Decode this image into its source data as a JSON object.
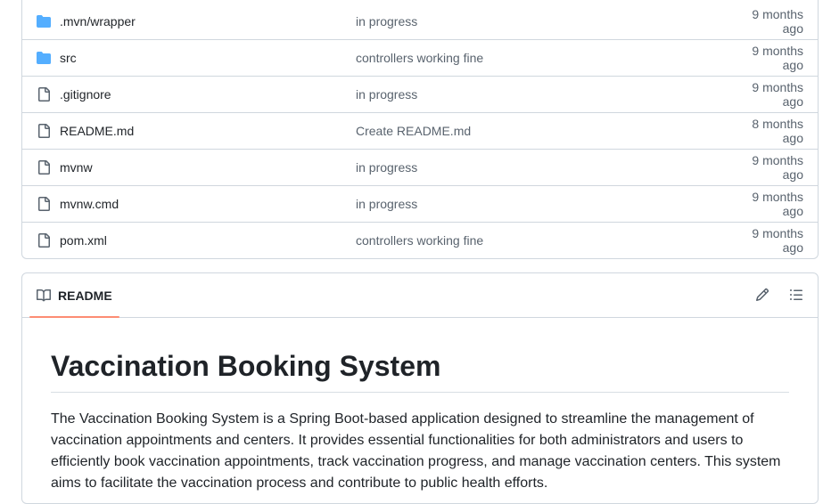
{
  "files": [
    {
      "type": "folder",
      "icon": "folder-icon",
      "name": ".mvn/wrapper",
      "message": "in progress",
      "date": "9 months ago"
    },
    {
      "type": "folder",
      "icon": "folder-icon",
      "name": "src",
      "message": "controllers working fine",
      "date": "9 months ago"
    },
    {
      "type": "file",
      "icon": "file-icon",
      "name": ".gitignore",
      "message": "in progress",
      "date": "9 months ago"
    },
    {
      "type": "file",
      "icon": "file-icon",
      "name": "README.md",
      "message": "Create README.md",
      "date": "8 months ago"
    },
    {
      "type": "file",
      "icon": "file-icon",
      "name": "mvnw",
      "message": "in progress",
      "date": "9 months ago"
    },
    {
      "type": "file",
      "icon": "file-icon",
      "name": "mvnw.cmd",
      "message": "in progress",
      "date": "9 months ago"
    },
    {
      "type": "file",
      "icon": "file-icon",
      "name": "pom.xml",
      "message": "controllers working fine",
      "date": "9 months ago"
    }
  ],
  "readme": {
    "tab_label": "README",
    "tab_icon": "book-icon",
    "edit_icon": "pencil-icon",
    "outline_icon": "list-icon",
    "title": "Vaccination Booking System",
    "paragraph": "The Vaccination Booking System is a Spring Boot-based application designed to streamline the management of vaccination appointments and centers. It provides essential functionalities for both administrators and users to efficiently book vaccination appointments, track vaccination progress, and manage vaccination centers. This system aims to facilitate the vaccination process and contribute to public health efforts."
  },
  "colors": {
    "folder": "#54aeff",
    "file_icon": "#59636e",
    "tab_underline": "#fd8c73",
    "border": "#d0d7de"
  }
}
